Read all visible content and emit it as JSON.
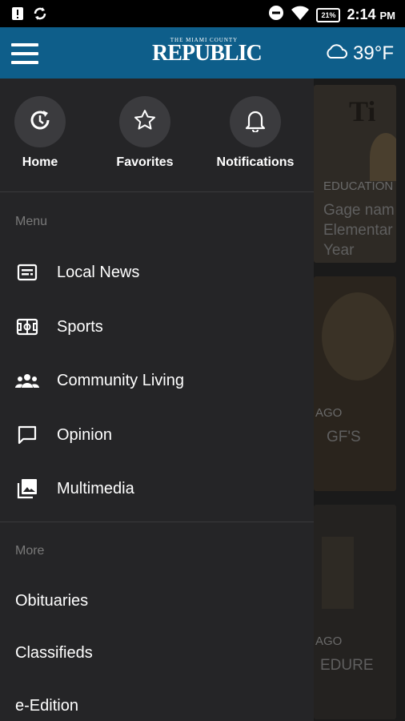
{
  "status_bar": {
    "time": "2:14",
    "ampm": "PM",
    "battery": "21%"
  },
  "app_bar": {
    "logo_small": "THE MIAMI COUNTY",
    "logo_big": "REPUBLIC",
    "temperature": "39°F"
  },
  "quick_links": [
    {
      "label": "Home",
      "icon": "home-refresh-icon"
    },
    {
      "label": "Favorites",
      "icon": "star-icon"
    },
    {
      "label": "Notifications",
      "icon": "bell-icon"
    }
  ],
  "menu": {
    "header": "Menu",
    "items": [
      {
        "label": "Local News",
        "icon": "newspaper-icon"
      },
      {
        "label": "Sports",
        "icon": "field-icon"
      },
      {
        "label": "Community Living",
        "icon": "people-icon"
      },
      {
        "label": "Opinion",
        "icon": "chat-icon"
      },
      {
        "label": "Multimedia",
        "icon": "photos-icon"
      }
    ]
  },
  "more": {
    "header": "More",
    "items": [
      "Obituaries",
      "Classifieds",
      "e-Edition"
    ]
  },
  "feed": {
    "card1": {
      "category": "EDUCATION",
      "headline_l1": "Gage nam",
      "headline_l2": "Elementar",
      "headline_l3": "Year"
    },
    "card2": {
      "category": "AGO",
      "headline": "GF'S"
    },
    "card3": {
      "category": "AGO",
      "headline": "EDURE"
    }
  }
}
